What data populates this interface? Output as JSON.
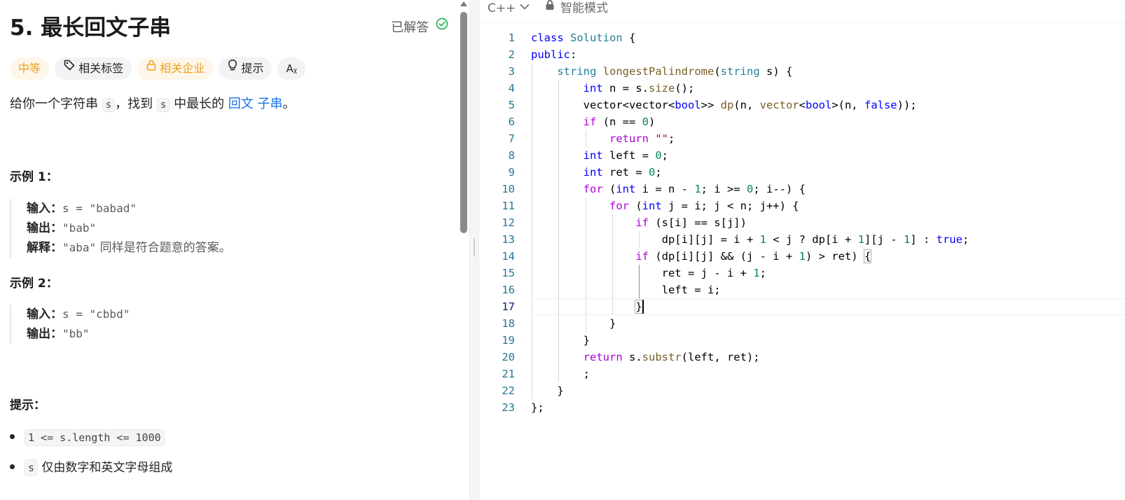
{
  "problem": {
    "title": "5. 最长回文子串",
    "solved_label": "已解答",
    "tags": {
      "difficulty": "中等",
      "related_tags": "相关标签",
      "related_companies": "相关企业",
      "hint": "提示",
      "translate_icon": "Aᵪ"
    },
    "description": {
      "part1": "给你一个字符串 ",
      "code1": "s",
      "part2": "，找到 ",
      "code2": "s",
      "part3": " 中最长的 ",
      "link1": "回文",
      "space": " ",
      "link2": "子串",
      "part4": "。"
    },
    "examples": [
      {
        "heading": "示例 1：",
        "input_label": "输入：",
        "input_value": "s = \"babad\"",
        "output_label": "输出：",
        "output_value": "\"bab\"",
        "explain_label": "解释：",
        "explain_value": "\"aba\"",
        "explain_text": " 同样是符合题意的答案。"
      },
      {
        "heading": "示例 2：",
        "input_label": "输入：",
        "input_value": "s = \"cbbd\"",
        "output_label": "输出：",
        "output_value": "\"bb\""
      }
    ],
    "constraints_heading": "提示：",
    "constraints": [
      {
        "code": "1 <= s.length <= 1000",
        "text": ""
      },
      {
        "code": "s",
        "text": " 仅由数字和英文字母组成"
      }
    ]
  },
  "editor": {
    "language": "C++",
    "mode": "智能模式",
    "active_line": 17,
    "lines": [
      "1",
      "2",
      "3",
      "4",
      "5",
      "6",
      "7",
      "8",
      "9",
      "10",
      "11",
      "12",
      "13",
      "14",
      "15",
      "16",
      "17",
      "18",
      "19",
      "20",
      "21",
      "22",
      "23"
    ]
  },
  "colors": {
    "link": "#1a73e8",
    "difficulty": "#f0a020",
    "solved_check": "#2db55d",
    "line_number": "#237893"
  },
  "icons": [
    "check-circle-icon",
    "tag-icon",
    "lock-icon",
    "lightbulb-icon",
    "translate-icon",
    "chevron-down-icon"
  ]
}
